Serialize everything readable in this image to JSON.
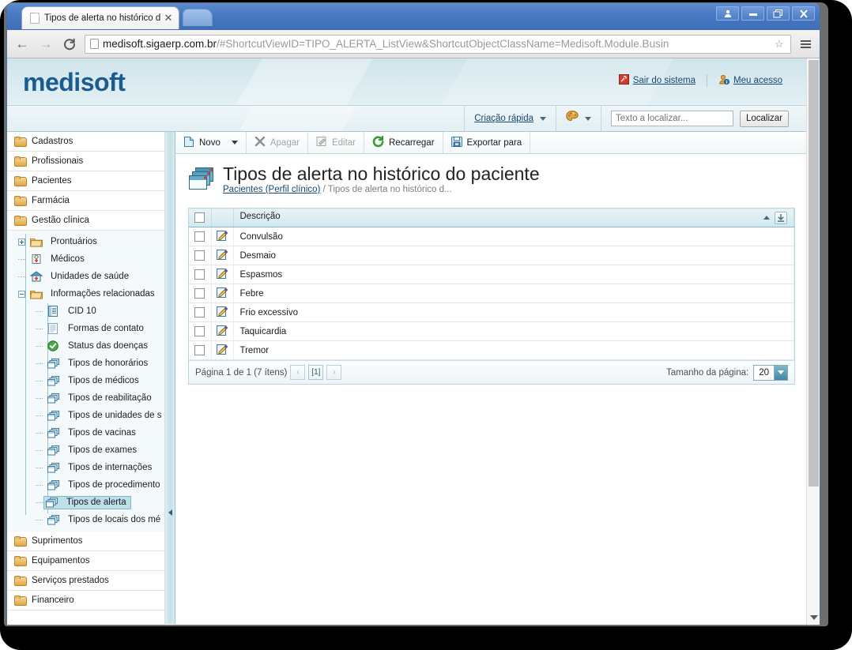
{
  "browser": {
    "tab_title": "Tipos de alerta no histórico d",
    "tab_close": "✕",
    "url_host": "medisoft.sigaerp.com.br",
    "url_path": "/#ShortcutViewID=TIPO_ALERTA_ListView&ShortcutObjectClassName=Medisoft.Module.Busin",
    "back_glyph": "←",
    "forward_glyph": "→",
    "reload_glyph": "C",
    "star_glyph": "☆"
  },
  "app_header": {
    "logo": "medisoft",
    "logout_label": "Sair do sistema",
    "my_access_label": "Meu acesso"
  },
  "subheader": {
    "quick_create_label": "Criação rápida",
    "search_placeholder": "Texto a localizar...",
    "search_value": "",
    "search_button": "Localizar"
  },
  "toolbar": {
    "new_label": "Novo",
    "delete_label": "Apagar",
    "edit_label": "Editar",
    "reload_label": "Recarregar",
    "export_label": "Exportar para"
  },
  "content": {
    "title": "Tipos de alerta no histórico do paciente",
    "breadcrumb_parent": "Pacientes (Perfil clínico)",
    "breadcrumb_sep": " / ",
    "breadcrumb_current": "Tipos de alerta no histórico d..."
  },
  "grid": {
    "columns": [
      "Descrição"
    ],
    "rows": [
      {
        "descricao": "Convulsão"
      },
      {
        "descricao": "Desmaio"
      },
      {
        "descricao": "Espasmos"
      },
      {
        "descricao": "Febre"
      },
      {
        "descricao": "Frio excessivo"
      },
      {
        "descricao": "Taquicardia"
      },
      {
        "descricao": "Tremor"
      }
    ],
    "footer": {
      "page_info": "Página 1 de 1 (7 ítens)",
      "prev_glyph": "‹",
      "current_page": "[1]",
      "next_glyph": "›",
      "page_size_label": "Tamanho da página:",
      "page_size_value": "20"
    }
  },
  "sidebar": {
    "top_groups": [
      {
        "label": "Cadastros"
      },
      {
        "label": "Profissionais"
      },
      {
        "label": "Pacientes"
      },
      {
        "label": "Farmácia"
      },
      {
        "label": "Gestão clínica"
      }
    ],
    "tree": [
      {
        "label": "Prontuários",
        "icon": "folder-icon",
        "level": 1,
        "toggle": "plus"
      },
      {
        "label": "Médicos",
        "icon": "doctor-icon",
        "level": 1,
        "toggle": "none"
      },
      {
        "label": "Unidades de saúde",
        "icon": "hospital-icon",
        "level": 1,
        "toggle": "none"
      },
      {
        "label": "Informações relacionadas",
        "icon": "folder-icon",
        "level": 1,
        "toggle": "minus"
      },
      {
        "label": "CID 10",
        "icon": "document-icon",
        "level": 2,
        "toggle": "none"
      },
      {
        "label": "Formas de contato",
        "icon": "page-icon",
        "level": 2,
        "toggle": "none"
      },
      {
        "label": "Status das doenças",
        "icon": "check-icon",
        "level": 2,
        "toggle": "none"
      },
      {
        "label": "Tipos de honorários",
        "icon": "cards-icon",
        "level": 2,
        "toggle": "none"
      },
      {
        "label": "Tipos de médicos",
        "icon": "cards-icon",
        "level": 2,
        "toggle": "none"
      },
      {
        "label": "Tipos de reabilitação",
        "icon": "cards-icon",
        "level": 2,
        "toggle": "none"
      },
      {
        "label": "Tipos de unidades de s",
        "icon": "cards-icon",
        "level": 2,
        "toggle": "none"
      },
      {
        "label": "Tipos de vacinas",
        "icon": "cards-icon",
        "level": 2,
        "toggle": "none"
      },
      {
        "label": "Tipos de exames",
        "icon": "cards-icon",
        "level": 2,
        "toggle": "none"
      },
      {
        "label": "Tipos de internações",
        "icon": "cards-icon",
        "level": 2,
        "toggle": "none"
      },
      {
        "label": "Tipos de procedimento",
        "icon": "cards-icon",
        "level": 2,
        "toggle": "none"
      },
      {
        "label": "Tipos de alerta",
        "icon": "cards-icon",
        "level": 2,
        "toggle": "none",
        "selected": true
      },
      {
        "label": "Tipos de locais dos mé",
        "icon": "cards-icon",
        "level": 2,
        "toggle": "none"
      }
    ],
    "bottom_groups": [
      {
        "label": "Suprimentos"
      },
      {
        "label": "Equipamentos"
      },
      {
        "label": "Serviços prestados"
      },
      {
        "label": "Financeiro"
      }
    ]
  },
  "colors": {
    "brand": "#1a5c8f",
    "header_bg": "#d7e9ef",
    "link": "#17486f",
    "selection": "#bcdfe8",
    "grid_header": "#d2e8ee"
  }
}
